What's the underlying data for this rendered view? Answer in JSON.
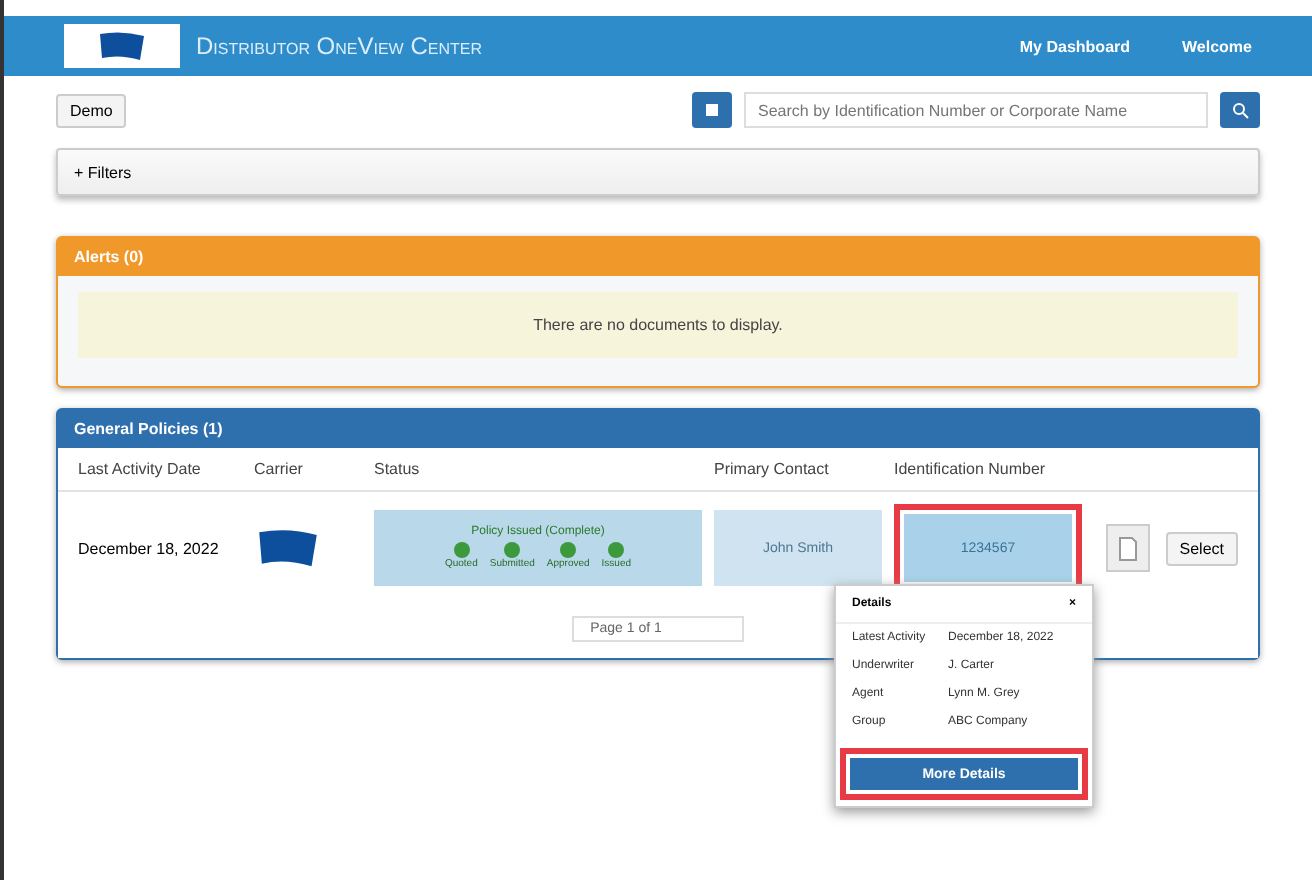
{
  "header": {
    "title": "Distributor OneView Center",
    "links": [
      "My Dashboard",
      "Welcome"
    ]
  },
  "toolbar": {
    "button": "Demo",
    "search": {
      "placeholder": "Search by Identification Number or Corporate Name"
    }
  },
  "filters": {
    "label": "+ Filters",
    "expanded": false
  },
  "alerts": {
    "title": "Alerts (0)",
    "message": "There are no documents to display."
  },
  "policies": {
    "title": "General Policies (1)",
    "columns": [
      "Last Activity Date",
      "Carrier",
      "Status",
      "Primary Contact",
      "Identification Number"
    ],
    "rows": [
      {
        "date": "December 18, 2022",
        "status_title": "Policy Issued (Complete)",
        "steps": [
          {
            "label": "Quoted",
            "done": true
          },
          {
            "label": "Submitted",
            "done": true
          },
          {
            "label": "Approved",
            "done": true
          },
          {
            "label": "Issued",
            "done": true
          }
        ],
        "contact": "John Smith",
        "id": "1234567",
        "highlighted": true,
        "action": "Select"
      }
    ],
    "pager": "Page 1 of 1"
  },
  "popover": {
    "title": "Details",
    "close": "×",
    "fields": [
      {
        "label": "Latest Activity",
        "value": "December 18, 2022"
      },
      {
        "label": "Underwriter",
        "value": "J. Carter"
      },
      {
        "label": "Agent",
        "value": "Lynn M. Grey"
      },
      {
        "label": "Group",
        "value": "ABC Company"
      }
    ],
    "button": "More Details",
    "highlighted": true
  }
}
